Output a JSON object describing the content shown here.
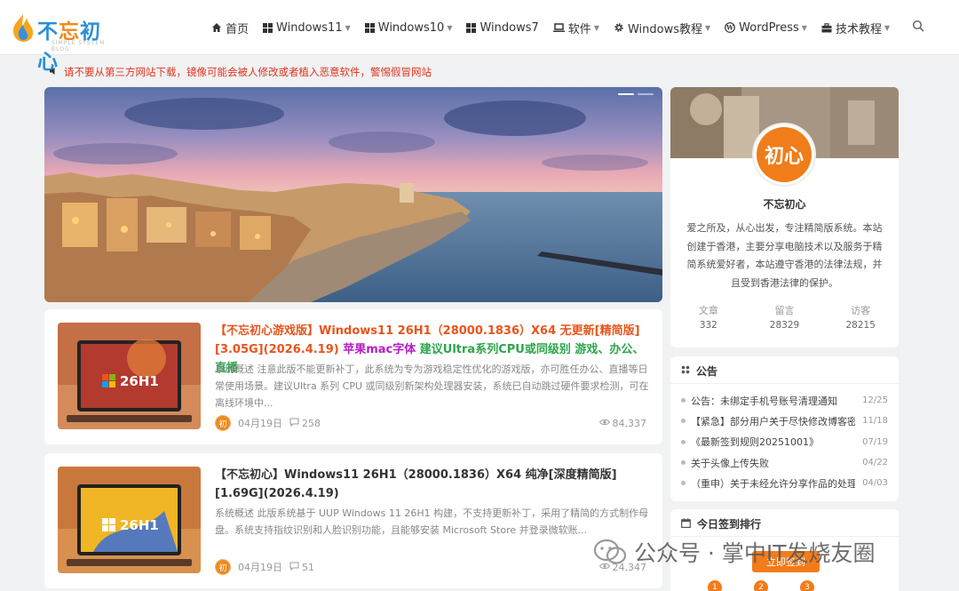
{
  "header": {
    "logo_text": "不忘初心",
    "logo_sub": "SIMPLE SYSTEM BLOG",
    "nav": [
      {
        "label": "首页",
        "icon": "home-icon",
        "has_dropdown": false
      },
      {
        "label": "Windows11",
        "icon": "windows-icon",
        "has_dropdown": true
      },
      {
        "label": "Windows10",
        "icon": "windows-icon",
        "has_dropdown": true
      },
      {
        "label": "Windows7",
        "icon": "windows-icon",
        "has_dropdown": false
      },
      {
        "label": "软件",
        "icon": "laptop-icon",
        "has_dropdown": true
      },
      {
        "label": "Windows教程",
        "icon": "gear-icon",
        "has_dropdown": true
      },
      {
        "label": "WordPress",
        "icon": "wordpress-icon",
        "has_dropdown": true
      },
      {
        "label": "技术教程",
        "icon": "briefcase-icon",
        "has_dropdown": true
      }
    ]
  },
  "notice": "请不要从第三方网站下载，镜像可能会被人修改或者植入恶意软件，警惕假冒网站",
  "articles": [
    {
      "title_parts": [
        {
          "text": "【不忘初心游戏版】Windows11 26H1（28000.1836）X64 无更新[精简版][3.05G](2026.4.19) ",
          "color": "orange"
        },
        {
          "text": "苹果mac字体 ",
          "color": "purple"
        },
        {
          "text": "建议Ultra系列CPU或同级别 游戏、办公、直播",
          "color": "green"
        }
      ],
      "excerpt": "系统概述 注意此版不能更新补丁，此系统为专为游戏稳定性优化的游戏版，亦可胜任办公、直播等日常使用场景。建议Ultra 系列 CPU 或同级别新架构处理器安装，系统已自动跳过硬件要求检测，可在离线环境中...",
      "thumb_label": "26H1",
      "date": "04月19日",
      "comments": "258",
      "views": "84,337"
    },
    {
      "title_parts": [
        {
          "text": "【不忘初心】Windows11 26H1（28000.1836）X64 纯净[深度精简版][1.69G](2026.4.19)",
          "color": "dark"
        }
      ],
      "excerpt": "系统概述 此版系统基于 UUP Windows 11 26H1 构建，不支持更新补丁，采用了精简的方式制作母盘。系统支持指纹识别和人脸识别功能，且能够安装 Microsoft Store 并登录微软账...",
      "thumb_label": "26H1",
      "date": "04月19日",
      "comments": "51",
      "views": "24,347"
    }
  ],
  "profile": {
    "avatar_text": "初心",
    "name": "不忘初心",
    "desc": "爱之所及，从心出发，专注精简版系统。本站创建于香港，主要分享电脑技术以及服务于精简系统爱好者，本站遵守香港的法律法规，并且受到香港法律的保护。",
    "stats": [
      {
        "label": "文章",
        "value": "332"
      },
      {
        "label": "留言",
        "value": "28329"
      },
      {
        "label": "访客",
        "value": "28215"
      }
    ]
  },
  "announcements": {
    "title": "公告",
    "items": [
      {
        "text": "公告：未绑定手机号账号清理通知",
        "date": "12/25"
      },
      {
        "text": "【紧急】部分用户关于尽快修改博客密码通知",
        "date": "11/18"
      },
      {
        "text": "《最新签到规则20251001》",
        "date": "07/19"
      },
      {
        "text": "关于头像上传失败",
        "date": "04/22"
      },
      {
        "text": "（重申）关于未经允许分享作品的处理办法",
        "date": "04/03"
      }
    ]
  },
  "signin": {
    "title": "今日签到排行",
    "button": "立即签到",
    "ranks": [
      "1",
      "2",
      "3"
    ]
  },
  "watermark": {
    "text": "公众号 · 掌中IT发烧友圈"
  }
}
